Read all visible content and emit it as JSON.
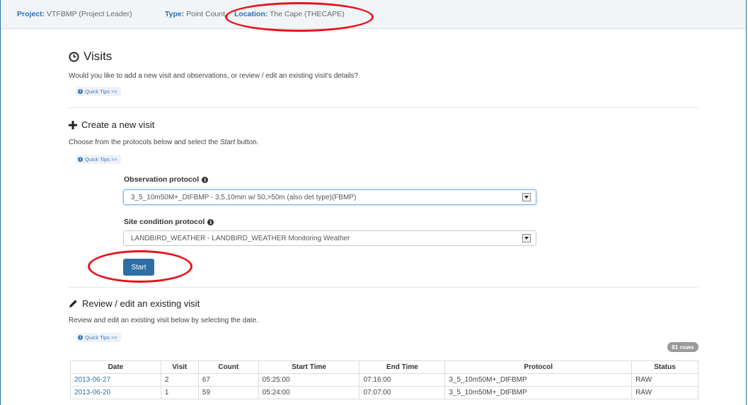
{
  "context": {
    "project_label": "Project:",
    "project_value": "VTFBMP (Project Leader)",
    "type_label": "Type:",
    "type_value": "Point Count",
    "location_label": "Location:",
    "location_value": "The Cape (THECAPE)"
  },
  "visits": {
    "title": "Visits",
    "intro": "Would you like to add a new visit and observations, or review / edit an existing visit's details?",
    "quick_tips": "Quick Tips >>"
  },
  "create": {
    "title": "Create a new visit",
    "desc_before": "Choose from the protocols below and select the ",
    "desc_em": "Start",
    "desc_after": " button.",
    "quick_tips": "Quick Tips >>",
    "observation_label": "Observation protocol",
    "observation_value": "3_5_10m50M+_DtFBMP - 3,5,10min w/ 50,>50m (also det type)(FBMP)",
    "site_label": "Site condition protocol",
    "site_value": "LANDBIRD_WEATHER - LANDBIRD_WEATHER Monitoring Weather",
    "start_label": "Start"
  },
  "review": {
    "title": "Review / edit an existing visit",
    "desc": "Review and edit an existing visit below by selecting the date.",
    "quick_tips": "Quick Tips >>",
    "rows_badge": "81 rows",
    "columns": [
      "Date",
      "Visit",
      "Count",
      "Start Time",
      "End Time",
      "Protocol",
      "Status"
    ],
    "rows": [
      [
        "2013-06-27",
        "2",
        "67",
        "05:25:00",
        "07:16:00",
        "3_5_10m50M+_DtFBMP",
        "RAW"
      ],
      [
        "2013-06-20",
        "1",
        "59",
        "05:24:00",
        "07:07:00",
        "3_5_10m50M+_DtFBMP",
        "RAW"
      ]
    ]
  },
  "colors": {
    "accent": "#2a6fb5",
    "button": "#2f6ea5",
    "annotation": "#e8121a"
  }
}
